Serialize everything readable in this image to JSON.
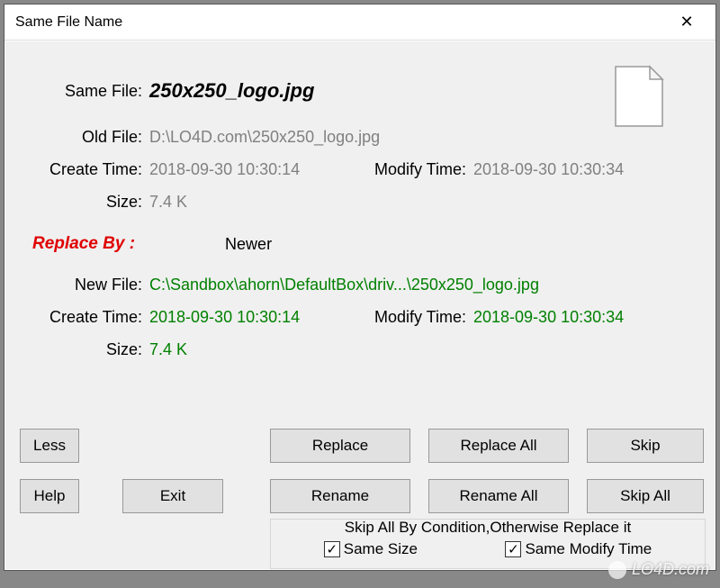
{
  "title": "Same File Name",
  "labels": {
    "same_file": "Same File:",
    "old_file": "Old File:",
    "new_file": "New File:",
    "create_time": "Create Time:",
    "modify_time": "Modify Time:",
    "size": "Size:",
    "replace_by": "Replace By  :"
  },
  "same_file_name": "250x250_logo.jpg",
  "old": {
    "path": "D:\\LO4D.com\\250x250_logo.jpg",
    "create_time": "2018-09-30 10:30:14",
    "modify_time": "2018-09-30 10:30:34",
    "size": "7.4 K"
  },
  "replace_mode": "Newer",
  "new": {
    "path": "C:\\Sandbox\\ahorn\\DefaultBox\\driv...\\250x250_logo.jpg",
    "create_time": "2018-09-30 10:30:14",
    "modify_time": "2018-09-30 10:30:34",
    "size": "7.4 K"
  },
  "buttons": {
    "less": "Less",
    "help": "Help",
    "exit": "Exit",
    "replace": "Replace",
    "replace_all": "Replace All",
    "skip": "Skip",
    "rename": "Rename",
    "rename_all": "Rename All",
    "skip_all": "Skip All"
  },
  "condition": {
    "title": "Skip All By Condition,Otherwise Replace it",
    "same_size_label": "Same Size",
    "same_size_checked": true,
    "same_modify_label": "Same Modify Time",
    "same_modify_checked": true
  },
  "watermark": "LO4D.com"
}
